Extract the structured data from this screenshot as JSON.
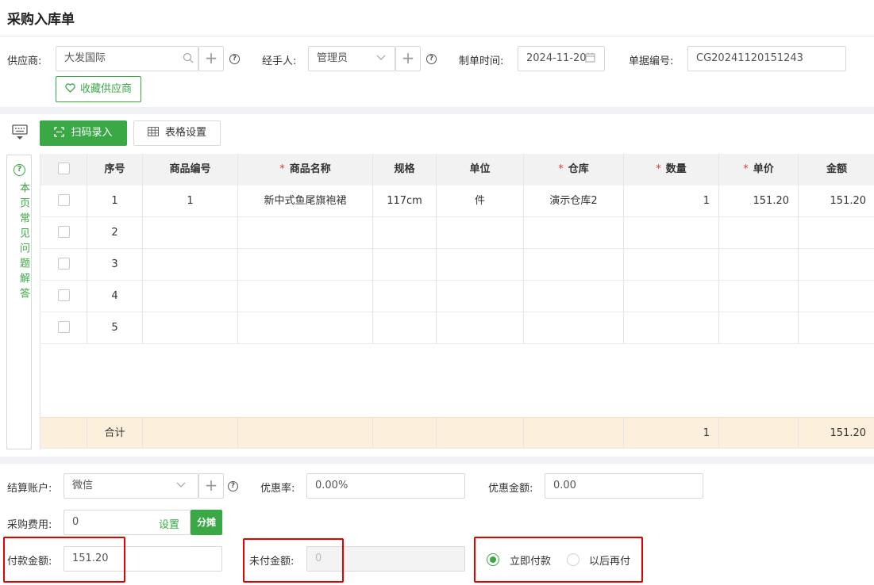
{
  "page": {
    "title": "采购入库单"
  },
  "header": {
    "supplier_label": "供应商:",
    "supplier_value": "大发国际",
    "handler_label": "经手人:",
    "handler_value": "管理员",
    "time_label": "制单时间:",
    "time_value": "2024-11-20",
    "docno_label": "单据编号:",
    "docno_value": "CG20241120151243",
    "fav_label": "收藏供应商"
  },
  "toolbar": {
    "scan_label": "扫码录入",
    "table_settings_label": "表格设置"
  },
  "faq": {
    "text": "本页常见问题解答"
  },
  "table": {
    "headers": {
      "seq": "序号",
      "code": "商品编号",
      "name": "商品名称",
      "spec": "规格",
      "unit": "单位",
      "warehouse": "仓库",
      "qty": "数量",
      "price": "单价",
      "amount": "金额"
    },
    "rows": [
      {
        "seq": "1",
        "code": "1",
        "name": "新中式鱼尾旗袍裙",
        "spec": "117cm",
        "unit": "件",
        "warehouse": "演示仓库2",
        "qty": "1",
        "price": "151.20",
        "amount": "151.20"
      },
      {
        "seq": "2",
        "code": "",
        "name": "",
        "spec": "",
        "unit": "",
        "warehouse": "",
        "qty": "",
        "price": "",
        "amount": ""
      },
      {
        "seq": "3",
        "code": "",
        "name": "",
        "spec": "",
        "unit": "",
        "warehouse": "",
        "qty": "",
        "price": "",
        "amount": ""
      },
      {
        "seq": "4",
        "code": "",
        "name": "",
        "spec": "",
        "unit": "",
        "warehouse": "",
        "qty": "",
        "price": "",
        "amount": ""
      },
      {
        "seq": "5",
        "code": "",
        "name": "",
        "spec": "",
        "unit": "",
        "warehouse": "",
        "qty": "",
        "price": "",
        "amount": ""
      }
    ],
    "total": {
      "label": "合计",
      "qty": "1",
      "amount": "151.20"
    }
  },
  "footer": {
    "account_label": "结算账户:",
    "account_value": "微信",
    "discount_rate_label": "优惠率:",
    "discount_rate_value": "0.00%",
    "discount_amount_label": "优惠金额:",
    "discount_amount_value": "0.00",
    "purchase_fee_label": "采购费用:",
    "purchase_fee_value": "0",
    "settings_link": "设置",
    "split_label": "分摊",
    "paid_label": "付款金额:",
    "paid_value": "151.20",
    "unpaid_label": "未付金额:",
    "unpaid_value": "0",
    "pay_now_label": "立即付款",
    "pay_later_label": "以后再付"
  },
  "colors": {
    "accent": "#3aa845",
    "highlight_border": "#e60000",
    "total_row": "#fcefdc"
  }
}
